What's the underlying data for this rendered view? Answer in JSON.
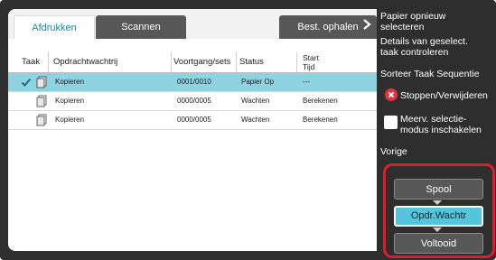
{
  "tabs": {
    "print": "Afdrukken",
    "scan": "Scannen",
    "fetch": "Best. ophalen"
  },
  "table": {
    "headers": {
      "task": "Taak",
      "job": "Opdrachtwachtrij",
      "progress": "Voortgang/sets",
      "status": "Status",
      "start_line1": "Start",
      "start_line2": "Tijd"
    },
    "rows": [
      {
        "name": "Kopieren",
        "progress": "0001/0010",
        "status": "Papier Op",
        "start": "---",
        "selected": true
      },
      {
        "name": "Kopieren",
        "progress": "0000/0005",
        "status": "Wachten",
        "start": "Berekenen",
        "selected": false
      },
      {
        "name": "Kopieren",
        "progress": "0000/0005",
        "status": "Wachten",
        "start": "Berekenen",
        "selected": false
      }
    ]
  },
  "menu": {
    "reselect_paper_1": "Papier opnieuw",
    "reselect_paper_2": "selecteren",
    "details_1": "Details van geselect.",
    "details_2": "taak controleren",
    "sort": "Sorteer Taak Sequentie",
    "stop_delete": "Stoppen/Verwijderen",
    "multi_select_1": "Meerv. selectie-",
    "multi_select_2": "modus inschakelen",
    "back": "Vorige"
  },
  "sort_panel": {
    "spool": "Spool",
    "queue": "Opdr.Wachtr",
    "done": "Voltooid",
    "active": "queue"
  },
  "colors": {
    "selected_row": "#8fd3e1",
    "active_button": "#55c5dc",
    "highlight_border": "#e01b2a",
    "stop_icon": "#d9363e"
  }
}
